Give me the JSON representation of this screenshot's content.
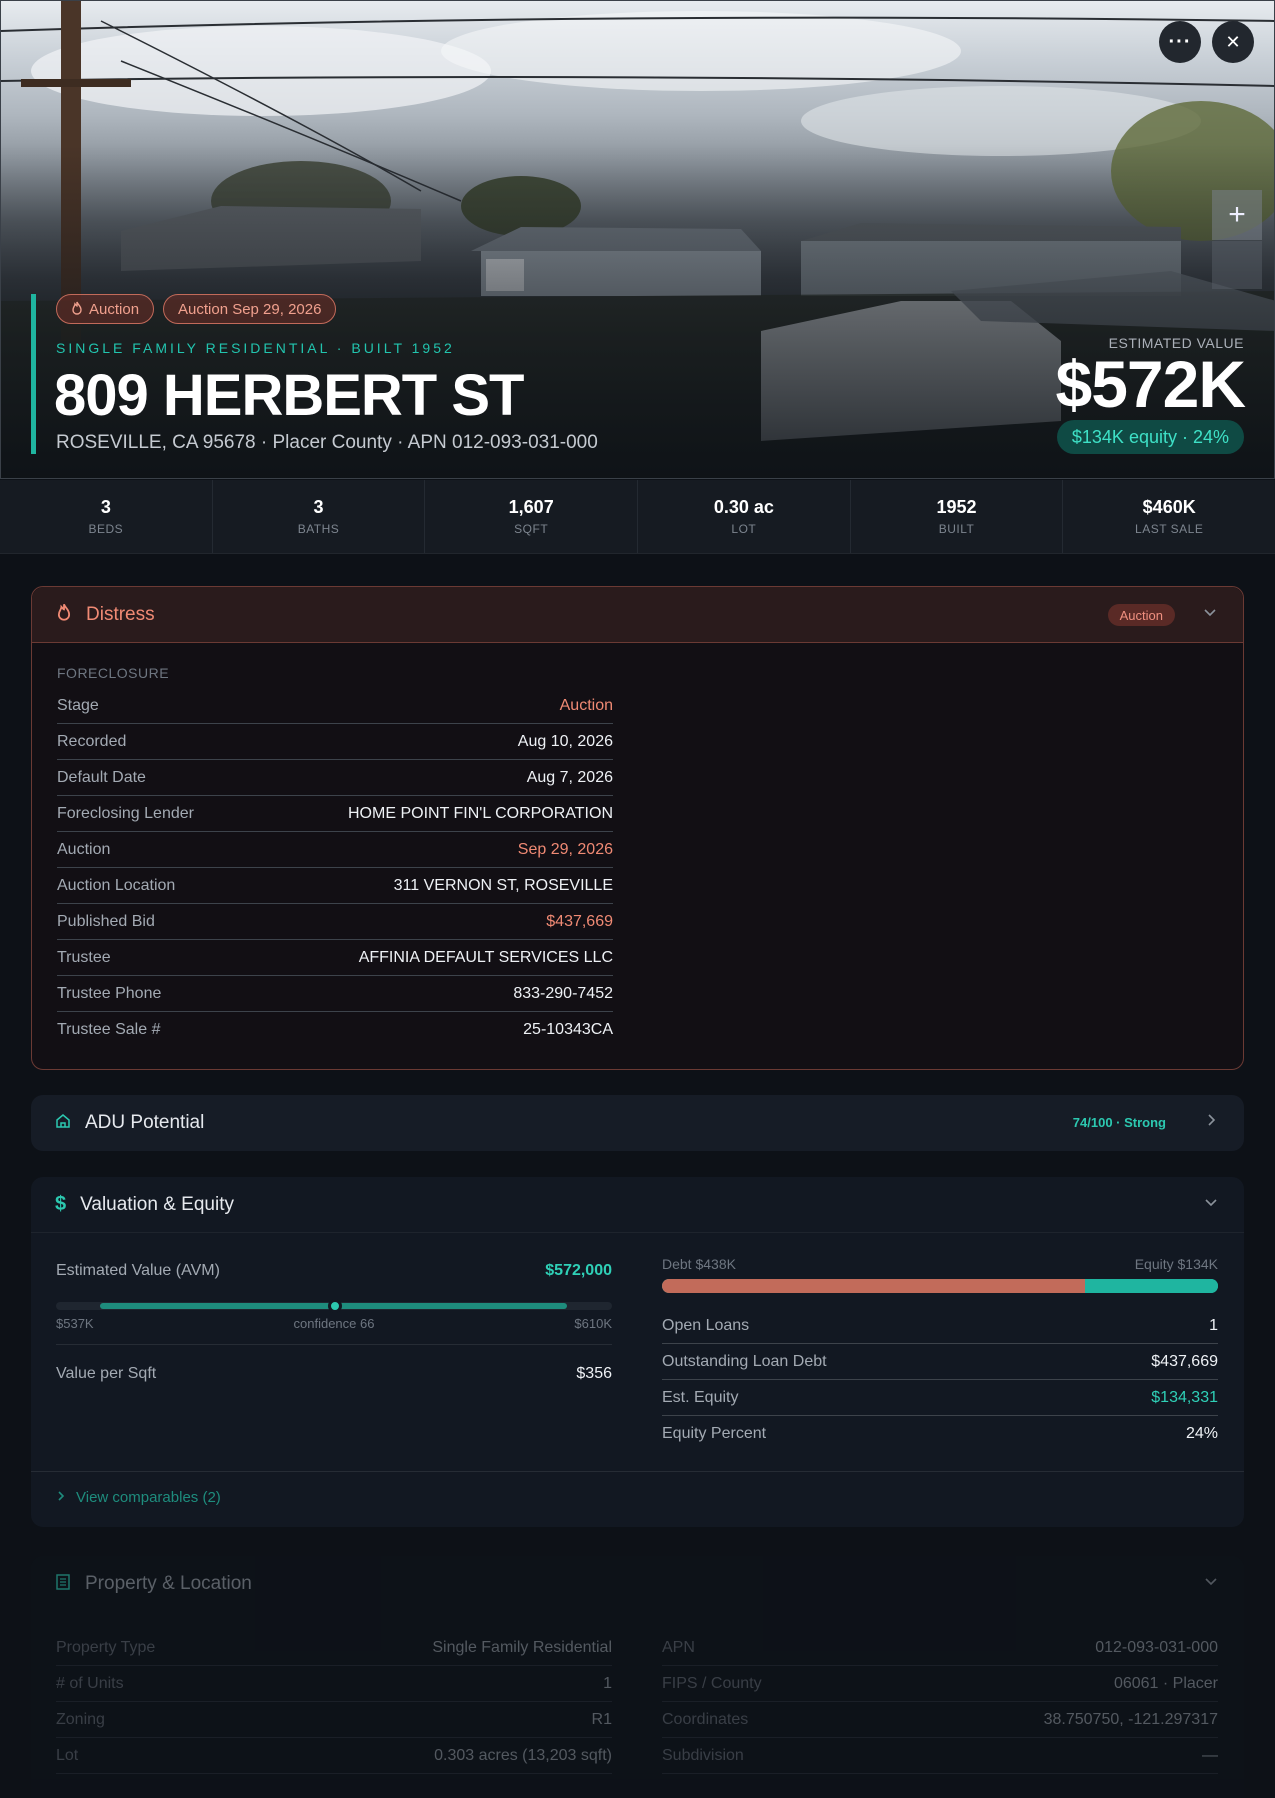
{
  "header": {
    "tags": [
      "Auction",
      "Auction Sep 29, 2026"
    ],
    "subtitle": "SINGLE FAMILY RESIDENTIAL · BUILT 1952",
    "address": "809 HERBERT ST",
    "location_line": "ROSEVILLE, CA 95678 · Placer County · APN 012-093-031-000",
    "estimated_value_label": "ESTIMATED VALUE",
    "estimated_value": "$572K",
    "equity_pill": "$134K equity · 24%",
    "more_glyph": "···",
    "close_glyph": "✕",
    "zoom_in_glyph": "+"
  },
  "stats": [
    {
      "value": "3",
      "label": "BEDS"
    },
    {
      "value": "3",
      "label": "BATHS"
    },
    {
      "value": "1,607",
      "label": "SQFT"
    },
    {
      "value": "0.30 ac",
      "label": "LOT"
    },
    {
      "value": "1952",
      "label": "BUILT"
    },
    {
      "value": "$460K",
      "label": "LAST SALE"
    }
  ],
  "distress": {
    "title": "Distress",
    "badge": "Auction",
    "section_label": "FORECLOSURE",
    "rows": [
      {
        "k": "Stage",
        "v": "Auction"
      },
      {
        "k": "Recorded",
        "v": "Aug 10, 2026"
      },
      {
        "k": "Default Date",
        "v": "Aug 7, 2026"
      },
      {
        "k": "Foreclosing Lender",
        "v": "HOME POINT FIN'L CORPORATION"
      },
      {
        "k": "Auction",
        "v": "Sep 29, 2026"
      },
      {
        "k": "Auction Location",
        "v": "311 VERNON ST, ROSEVILLE"
      },
      {
        "k": "Published Bid",
        "v": "$437,669"
      },
      {
        "k": "Trustee",
        "v": "AFFINIA DEFAULT SERVICES LLC"
      },
      {
        "k": "Trustee Phone",
        "v": "833-290-7452"
      },
      {
        "k": "Trustee Sale #",
        "v": "25-10343CA"
      }
    ]
  },
  "adu": {
    "title": "ADU Potential",
    "score": "74/100 · Strong"
  },
  "valuation": {
    "title": "Valuation & Equity",
    "avm_label": "Estimated Value (AVM)",
    "avm_value": "$572,000",
    "range_low": "$537K",
    "confidence": "confidence 66",
    "range_high": "$610K",
    "value_per_sqft_label": "Value per Sqft",
    "value_per_sqft": "$356",
    "debt_label": "Debt $438K",
    "equity_label": "Equity $134K",
    "equity_fraction": 0.24,
    "rows": [
      {
        "k": "Open Loans",
        "v": "1"
      },
      {
        "k": "Outstanding Loan Debt",
        "v": "$437,669"
      },
      {
        "k": "Est. Equity",
        "v": "$134,331"
      },
      {
        "k": "Equity Percent",
        "v": "24%"
      }
    ],
    "comparables_link": "View comparables (2)"
  },
  "property": {
    "title": "Property & Location",
    "left_rows": [
      {
        "k": "Property Type",
        "v": "Single Family Residential"
      },
      {
        "k": "# of Units",
        "v": "1"
      },
      {
        "k": "Zoning",
        "v": "R1"
      },
      {
        "k": "Lot",
        "v": "0.303 acres (13,203 sqft)"
      }
    ],
    "right_rows": [
      {
        "k": "APN",
        "v": "012-093-031-000"
      },
      {
        "k": "FIPS / County",
        "v": "06061 · Placer"
      },
      {
        "k": "Coordinates",
        "v": "38.750750, -121.297317"
      },
      {
        "k": "Subdivision",
        "v": "—"
      }
    ]
  },
  "colors": {
    "accent": "#1fb5a0",
    "distress": "#f08a74",
    "debt": "#c26b5a",
    "equity": "#1fb5a0"
  }
}
